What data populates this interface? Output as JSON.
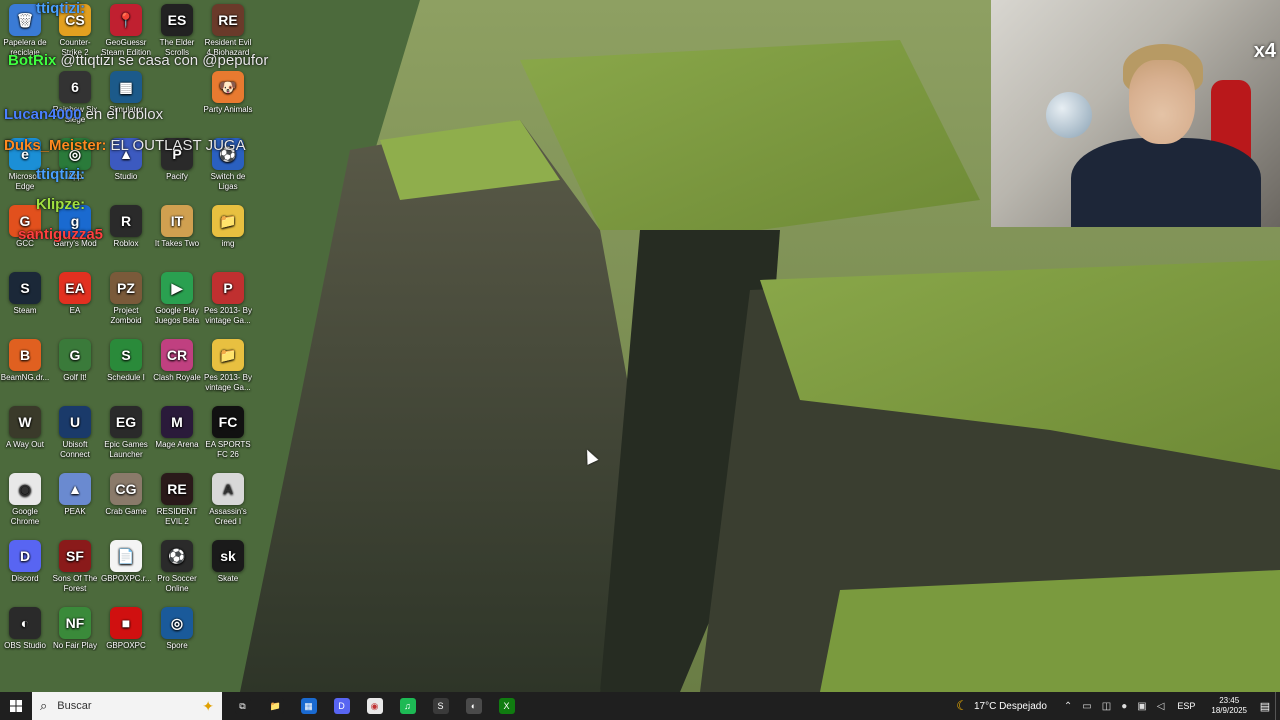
{
  "desktop": {
    "icons": [
      {
        "label": "Papelera de reciclaje",
        "color": "#3a7bd5",
        "glyph": "🗑"
      },
      {
        "label": "Counter-Strike 2",
        "color": "#e2a020",
        "glyph": "CS"
      },
      {
        "label": "GeoGuessr Steam Edition",
        "color": "#c02030",
        "glyph": "📍"
      },
      {
        "label": "The Elder Scrolls",
        "color": "#222222",
        "glyph": "ES"
      },
      {
        "label": "Resident Evil 4 Biohazard",
        "color": "#6a3a2a",
        "glyph": "RE"
      },
      {
        "label": "Rainbow Six Siege",
        "color": "#333333",
        "glyph": "6"
      },
      {
        "label": "Simulator",
        "color": "#1c5a8a",
        "glyph": "▦"
      },
      {
        "label": "Party Animals",
        "color": "#e87a30",
        "glyph": "🐶"
      },
      {
        "label": "Microsoft Edge",
        "color": "#1b8fd6",
        "glyph": "e"
      },
      {
        "label": "App",
        "color": "#2a7a3a",
        "glyph": "◎"
      },
      {
        "label": "Studio",
        "color": "#3c5ac0",
        "glyph": "▲"
      },
      {
        "label": "Pacify",
        "color": "#2a2a2a",
        "glyph": "P"
      },
      {
        "label": "Switch de Ligas",
        "color": "#2a60c0",
        "glyph": "⚽"
      },
      {
        "label": "GCC",
        "color": "#e2501d",
        "glyph": "G"
      },
      {
        "label": "Garry's Mod",
        "color": "#1a6ad0",
        "glyph": "g"
      },
      {
        "label": "Roblox",
        "color": "#2a2a2a",
        "glyph": "R"
      },
      {
        "label": "It Takes Two",
        "color": "#d0a050",
        "glyph": "IT"
      },
      {
        "label": "img",
        "color": "#e8c040",
        "glyph": "📁"
      },
      {
        "label": "Steam",
        "color": "#1b2838",
        "glyph": "S"
      },
      {
        "label": "EA",
        "color": "#e23020",
        "glyph": "EA"
      },
      {
        "label": "Project Zomboid",
        "color": "#7a5a3a",
        "glyph": "PZ"
      },
      {
        "label": "Google Play Juegos Beta",
        "color": "#2aa050",
        "glyph": "▶"
      },
      {
        "label": "Pes 2013- By vintage Ga...",
        "color": "#c03030",
        "glyph": "P"
      },
      {
        "label": "BeamNG.dr...",
        "color": "#e06020",
        "glyph": "B"
      },
      {
        "label": "Golf It!",
        "color": "#3a7a3a",
        "glyph": "G"
      },
      {
        "label": "Schedule I",
        "color": "#2a8a3a",
        "glyph": "S"
      },
      {
        "label": "Clash Royale",
        "color": "#c04080",
        "glyph": "CR"
      },
      {
        "label": "Pes 2013- By vintage Ga...",
        "color": "#e8c040",
        "glyph": "📁"
      },
      {
        "label": "A Way Out",
        "color": "#3a3a2a",
        "glyph": "W"
      },
      {
        "label": "Ubisoft Connect",
        "color": "#1a3a6a",
        "glyph": "U"
      },
      {
        "label": "Epic Games Launcher",
        "color": "#2a2a2a",
        "glyph": "EG"
      },
      {
        "label": "Mage Arena",
        "color": "#2a1a3a",
        "glyph": "M"
      },
      {
        "label": "EA SPORTS FC 26",
        "color": "#111111",
        "glyph": "FC"
      },
      {
        "label": "Google Chrome",
        "color": "#e8e8e8",
        "glyph": "◉"
      },
      {
        "label": "PEAK",
        "color": "#6a8ad0",
        "glyph": "▲"
      },
      {
        "label": "Crab Game",
        "color": "#8a7a6a",
        "glyph": "CG"
      },
      {
        "label": "RESIDENT EVIL 2",
        "color": "#2a1a1a",
        "glyph": "RE"
      },
      {
        "label": "Assassin's Creed I",
        "color": "#d8d8d8",
        "glyph": "A"
      },
      {
        "label": "Discord",
        "color": "#5865f2",
        "glyph": "D"
      },
      {
        "label": "Sons Of The Forest",
        "color": "#8a1a1a",
        "glyph": "SF"
      },
      {
        "label": "GBPOXPC.r...",
        "color": "#f4f4f4",
        "glyph": "📄"
      },
      {
        "label": "Pro Soccer Online",
        "color": "#2a2a2a",
        "glyph": "⚽"
      },
      {
        "label": "Skate",
        "color": "#1a1a1a",
        "glyph": "sk"
      },
      {
        "label": "OBS Studio",
        "color": "#2a2a2a",
        "glyph": "◐"
      },
      {
        "label": "No Fair Play",
        "color": "#3a8a3a",
        "glyph": "NF"
      },
      {
        "label": "GBPOXPC",
        "color": "#d01010",
        "glyph": "■"
      },
      {
        "label": "Spore",
        "color": "#1a5a9a",
        "glyph": "◎"
      }
    ]
  },
  "chat": [
    {
      "user": "ttiqtizi:",
      "msg": "",
      "color": "#4aa0ff"
    },
    {
      "user": "BotRix",
      "msg": "@ttiqtizi se casa con @pepufor",
      "color": "#40ff40"
    },
    {
      "user": "Lucan4000",
      "msg": "en el roblox",
      "color": "#4a80ff"
    },
    {
      "user": "Duks_Meister:",
      "msg": "EL OUTLAST JUGA",
      "color": "#ff8a20"
    },
    {
      "user": "ttiqtizi:",
      "msg": "",
      "color": "#4aa0ff"
    },
    {
      "user": "Klipze:",
      "msg": "",
      "color": "#a0e040"
    },
    {
      "user": "santiguzza5",
      "msg": "",
      "color": "#ff4040"
    }
  ],
  "webcam": {
    "badge": "x4"
  },
  "taskbar": {
    "search_placeholder": "Buscar",
    "pinned": [
      {
        "name": "task-view",
        "glyph": "⧉",
        "color": "#1f1f1f"
      },
      {
        "name": "file-explorer",
        "glyph": "📁",
        "color": "#1f1f1f"
      },
      {
        "name": "microsoft-store",
        "glyph": "▦",
        "color": "#1a6ad0"
      },
      {
        "name": "discord",
        "glyph": "D",
        "color": "#5865f2"
      },
      {
        "name": "chrome",
        "glyph": "◉",
        "color": "#e8e8e8"
      },
      {
        "name": "spotify",
        "glyph": "♫",
        "color": "#1db954"
      },
      {
        "name": "steam",
        "glyph": "S",
        "color": "#3a3a3a"
      },
      {
        "name": "obs",
        "glyph": "◐",
        "color": "#4a4a4a"
      },
      {
        "name": "xbox",
        "glyph": "X",
        "color": "#107c10"
      }
    ],
    "weather": {
      "temp": "17°C",
      "condition": "Despejado"
    },
    "language": "ESP",
    "time": "23:45",
    "date": "18/9/2025"
  }
}
